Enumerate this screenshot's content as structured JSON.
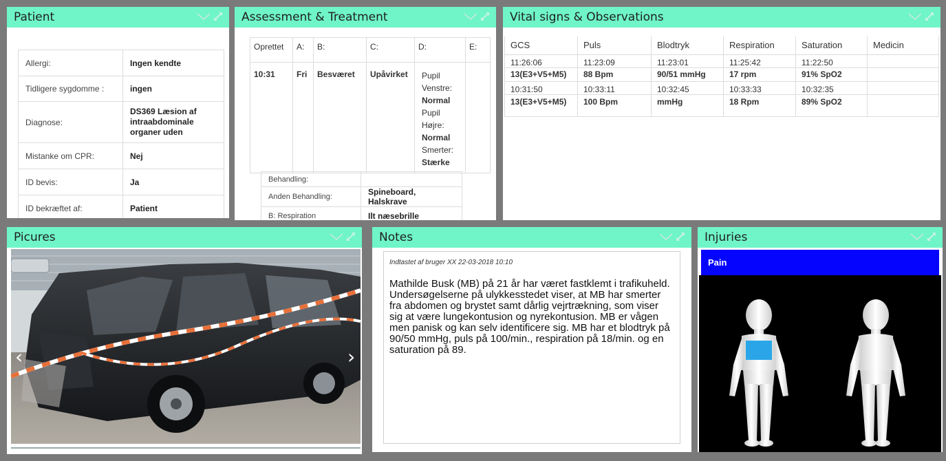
{
  "panels": {
    "patient": {
      "title": "Patient"
    },
    "assessment": {
      "title": "Assessment & Treatment"
    },
    "vitals": {
      "title": "Vital signs & Observations"
    },
    "pictures": {
      "title": "Picures"
    },
    "notes": {
      "title": "Notes"
    },
    "injuries": {
      "title": "Injuries"
    }
  },
  "patient": {
    "rows": [
      {
        "label": "Allergi:",
        "value": "Ingen kendte"
      },
      {
        "label": "Tidligere sygdomme :",
        "value": "ingen"
      },
      {
        "label": "Diagnose:",
        "value": "DS369 Læsion af intraabdominale organer uden"
      },
      {
        "label": "Mistanke om CPR:",
        "value": "Nej"
      },
      {
        "label": "ID bevis:",
        "value": "Ja"
      },
      {
        "label": "ID bekræftet af:",
        "value": "Patient"
      }
    ]
  },
  "assessment": {
    "headers": [
      "Oprettet",
      "A:",
      "B:",
      "C:",
      "D:",
      "E:"
    ],
    "row": {
      "oprettet": "10:31",
      "a": "Fri",
      "b": "Besværet",
      "c": "Upåvirket",
      "d": [
        {
          "label": "Pupil Venstre:",
          "value": "Normal"
        },
        {
          "label": "Pupil Højre:",
          "value": "Normal"
        },
        {
          "label": "Smerter:",
          "value": "Stærke"
        }
      ],
      "e": ""
    },
    "treatment": [
      {
        "label": "Behandling:",
        "value": ""
      },
      {
        "label": "Anden Behandling:",
        "value": "Spineboard, Halskrave"
      },
      {
        "label": "B: Respiration",
        "value": "Ilt næsebrille"
      }
    ]
  },
  "vitals": {
    "headers": [
      "GCS",
      "Puls",
      "Blodtryk",
      "Respiration",
      "Saturation",
      "Medicin"
    ],
    "entries": [
      {
        "times": [
          "11:26:06",
          "11:23:09",
          "11:23:01",
          "11:25:42",
          "11:22:50",
          ""
        ],
        "values": [
          "13(E3+V5+M5)",
          "88 Bpm",
          "90/51 mmHg",
          "17 rpm",
          "91% SpO2",
          ""
        ]
      },
      {
        "times": [
          "10:31:50",
          "10:33:11",
          "10:32:45",
          "10:33:33",
          "10:32:35",
          ""
        ],
        "values": [
          "13(E3+V5+M5)",
          "100 Bpm",
          "mmHg",
          "18 Rpm",
          "89% SpO2",
          ""
        ]
      }
    ]
  },
  "pictures": {
    "prev": "‹",
    "next": "›"
  },
  "notes": {
    "meta": "Indtastet af bruger XX 22-03-2018 10:10",
    "text": "Mathilde Busk (MB) på 21 år har været fastklemt i trafikuheld. Undersøgelserne på ulykkesstedet viser, at MB har smerter fra abdomen og brystet samt dårlig vejrtrækning, som viser sig at være lungekontusion og nyrekontusion. MB er vågen men panisk og kan selv identificere sig. MB har et blodtryk på 90/50 mmHg, puls på 100/min., respiration på 18/min. og en saturation på 89."
  },
  "injuries": {
    "filter": "Pain"
  },
  "colors": {
    "header": "#6ff5c8",
    "pain": "#0505ff",
    "injury_marker": "#2aa6e8"
  },
  "icons": [
    "chevron-down-icon",
    "expand-icon",
    "car-photo",
    "body-front-figure",
    "body-back-figure"
  ]
}
